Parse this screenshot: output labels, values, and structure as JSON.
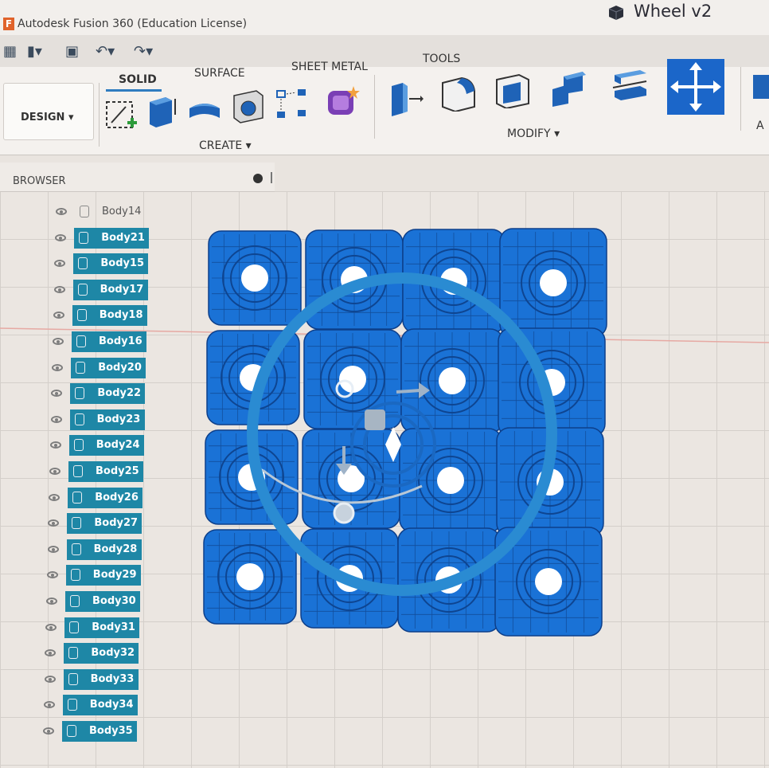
{
  "titlebar": {
    "app_logo": "F",
    "app_title": "Autodesk Fusion 360 (Education License)",
    "doc_icon": "cube-icon",
    "doc_title": "Wheel v2"
  },
  "quickbar": {
    "icons": [
      "grid-icon",
      "file-icon",
      "save-icon",
      "undo-icon",
      "redo-icon"
    ]
  },
  "ribbon": {
    "workspace": "DESIGN ▾",
    "tabs": [
      "SOLID",
      "SURFACE",
      "SHEET METAL",
      "TOOLS"
    ],
    "active_tab": "SOLID",
    "groups": {
      "create": "CREATE ▾",
      "modify": "MODIFY ▾",
      "assemble_partial": "A"
    },
    "create_tools": [
      "create-sketch-icon",
      "extrude-icon",
      "revolve-icon",
      "hole-icon",
      "pattern-icon",
      "create-form-icon"
    ],
    "modify_tools": [
      "press-pull-icon",
      "fillet-icon",
      "shell-icon",
      "combine-icon",
      "split-body-icon",
      "move-copy-icon"
    ]
  },
  "browser": {
    "title": "BROWSER",
    "bodies": [
      {
        "name": "Body14",
        "highlighted": false
      },
      {
        "name": "Body21",
        "highlighted": true
      },
      {
        "name": "Body15",
        "highlighted": true
      },
      {
        "name": "Body17",
        "highlighted": true
      },
      {
        "name": "Body18",
        "highlighted": true
      },
      {
        "name": "Body16",
        "highlighted": true
      },
      {
        "name": "Body20",
        "highlighted": true
      },
      {
        "name": "Body22",
        "highlighted": true
      },
      {
        "name": "Body23",
        "highlighted": true
      },
      {
        "name": "Body24",
        "highlighted": true
      },
      {
        "name": "Body25",
        "highlighted": true
      },
      {
        "name": "Body26",
        "highlighted": true
      },
      {
        "name": "Body27",
        "highlighted": true
      },
      {
        "name": "Body28",
        "highlighted": true
      },
      {
        "name": "Body29",
        "highlighted": true
      },
      {
        "name": "Body30",
        "highlighted": true
      },
      {
        "name": "Body31",
        "highlighted": true
      },
      {
        "name": "Body32",
        "highlighted": true
      },
      {
        "name": "Body33",
        "highlighted": true
      },
      {
        "name": "Body34",
        "highlighted": true
      },
      {
        "name": "Body35",
        "highlighted": true
      }
    ]
  },
  "colors": {
    "selection": "#1e87a6",
    "body_blue": "#1a72d6",
    "accent": "#2f7cc0"
  }
}
